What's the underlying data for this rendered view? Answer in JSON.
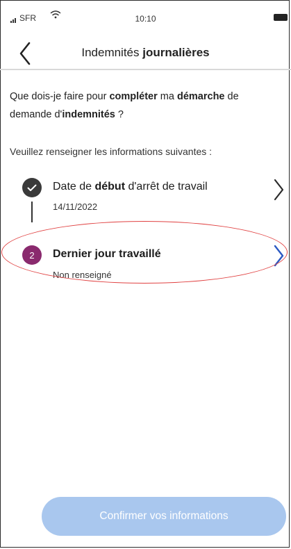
{
  "status_bar": {
    "carrier": "SFR",
    "time": "10:10"
  },
  "nav": {
    "title_prefix": "Indemnités ",
    "title_bold": "journalières"
  },
  "question": {
    "part1": "Que dois-je faire pour ",
    "part2_bold": "compléter",
    "part3": " ma ",
    "part4_bold": "démarche",
    "part5": " de ",
    "part6": "demande d'",
    "part7_bold": "indemnités",
    "part8": " ?"
  },
  "intro": "Veuillez renseigner les informations suivantes :",
  "steps": [
    {
      "status": "done",
      "title_prefix": "Date de ",
      "title_bold": "début",
      "title_suffix": " d'arrêt de travail",
      "subtitle": "14/11/2022"
    },
    {
      "number": "2",
      "status": "current",
      "title": "Dernier jour travaillé",
      "subtitle": "Non renseigné"
    }
  ],
  "confirm_label": "Confirmer vos informations",
  "colors": {
    "done_badge": "#3a3a3a",
    "current_badge": "#8a2a6e",
    "chevron_active": "#2b59c3",
    "button_disabled": "#a9c7ee",
    "annotation": "#e04040"
  },
  "icons": [
    "signal-icon",
    "wifi-icon",
    "battery-icon",
    "back-chevron-icon",
    "check-icon",
    "chevron-right-icon"
  ]
}
